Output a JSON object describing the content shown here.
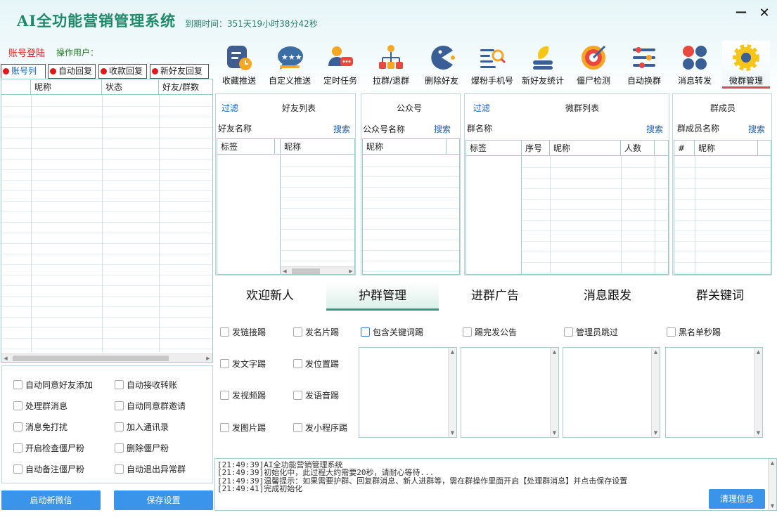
{
  "app": {
    "title": "AI全功能营销管理系统",
    "expire": "到期时间：351天19小时38分42秒",
    "minimize": "—",
    "close": "✕"
  },
  "account": {
    "login": "账号登陆",
    "operator": "操作用户："
  },
  "left_tabs": [
    {
      "label": "账号列"
    },
    {
      "label": "自动回复"
    },
    {
      "label": "收款回复"
    },
    {
      "label": "新好友回复"
    }
  ],
  "account_table": {
    "columns": [
      "",
      "昵称",
      "状态",
      "好友/群数"
    ]
  },
  "toolbar": [
    {
      "label": "收藏推送",
      "icon": "clock-chart-icon"
    },
    {
      "label": "自定义推送",
      "icon": "chat-stars-icon"
    },
    {
      "label": "定时任务",
      "icon": "user-chat-icon"
    },
    {
      "label": "拉群/退群",
      "icon": "org-chart-icon"
    },
    {
      "label": "删除好友",
      "icon": "pacman-icon"
    },
    {
      "label": "爆粉手机号",
      "icon": "list-search-icon"
    },
    {
      "label": "新好友统计",
      "icon": "bulb-icon"
    },
    {
      "label": "僵尸检测",
      "icon": "target-icon"
    },
    {
      "label": "自动换群",
      "icon": "sliders-icon"
    },
    {
      "label": "消息转发",
      "icon": "dots-grid-icon"
    },
    {
      "label": "微群管理",
      "icon": "gear-icon"
    }
  ],
  "friends_panel": {
    "filter": "过滤",
    "title": "好友列表",
    "field_label": "好友名称",
    "search": "搜索",
    "columns": [
      "标签",
      "昵称"
    ]
  },
  "official_panel": {
    "title": "公众号",
    "field_label": "公众号名称",
    "search": "搜索",
    "columns": [
      "昵称"
    ]
  },
  "groups_panel": {
    "filter": "过滤",
    "title": "微群列表",
    "field_label": "群名称",
    "search": "搜索",
    "columns": [
      "标签",
      "序号",
      "昵称",
      "人数"
    ]
  },
  "members_panel": {
    "title": "群成员",
    "field_label": "群成员名称",
    "search": "搜索",
    "columns": [
      "#",
      "昵称"
    ]
  },
  "section_tabs": [
    {
      "label": "欢迎新人"
    },
    {
      "label": "护群管理"
    },
    {
      "label": "进群广告"
    },
    {
      "label": "消息跟发"
    },
    {
      "label": "群关键词"
    }
  ],
  "kick_options": {
    "col1": [
      "发链接踢",
      "发文字踢",
      "发视频踢",
      "发图片踢"
    ],
    "col2": [
      "发名片踢",
      "发位置踢",
      "发语音踢",
      "发小程序踢"
    ],
    "keyword": "包含关键词踢",
    "announce": "踢完发公告",
    "admin_skip": "管理员跳过",
    "blacklist": "黑名单秒踢"
  },
  "settings": {
    "left": [
      "自动同意好友添加",
      "处理群消息",
      "消息免打扰",
      "开启检查僵尸粉",
      "自动备注僵尸粉"
    ],
    "right": [
      "自动接收转账",
      "自动同意群邀请",
      "加入通讯录",
      "删除僵尸粉",
      "自动退出异常群"
    ]
  },
  "buttons": {
    "start_wechat": "启动新微信",
    "save_settings": "保存设置",
    "clear_info": "清理信息"
  },
  "log": [
    "[21:49:39]AI全功能营销管理系统",
    "[21:49:39]初始化中，此过程大约需要20秒，请耐心等待...",
    "[21:49:39]温馨提示：如果需要护群、回复群消息、新人进群等，需在群操作里面开启【处理群消息】并点击保存设置",
    "[21:49:41]完成初始化"
  ],
  "colors": {
    "accent": "#3a94ea",
    "title": "#1f8a6a",
    "active_underline": "#d8484e",
    "section_active": "#2e9a82"
  }
}
